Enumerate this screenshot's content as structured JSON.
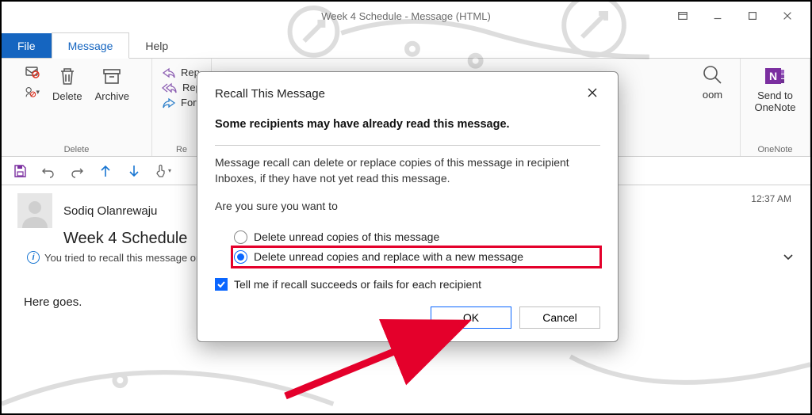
{
  "titlebar": {
    "text": "Week 4 Schedule  -  Message (HTML)"
  },
  "tabs": {
    "file": "File",
    "message": "Message",
    "help": "Help"
  },
  "ribbon": {
    "delete_group_label": "Delete",
    "delete": "Delete",
    "archive": "Archive",
    "respond": {
      "reply": "Rep",
      "replyall": "Rep",
      "forward": "Forv",
      "group_label": "Re"
    },
    "zoom": "oom",
    "onenote": "Send to\nOneNote",
    "onenote_label": "OneNote"
  },
  "message": {
    "sender": "Sodiq Olanrewaju",
    "time": "12:37 AM",
    "subject": "Week 4 Schedule",
    "notice": "You tried to recall this message on",
    "body": "Here goes."
  },
  "dialog": {
    "title": "Recall This Message",
    "headline": "Some recipients may have already read this message.",
    "explain": "Message recall can delete or replace copies of this message in recipient Inboxes, if they have not yet read this message.",
    "areyousure": "Are you sure you want to",
    "opt_delete": "Delete unread copies of this message",
    "opt_replace": "Delete unread copies and replace with a new message",
    "tellme": "Tell me if recall succeeds or fails for each recipient",
    "ok": "OK",
    "cancel": "Cancel"
  }
}
